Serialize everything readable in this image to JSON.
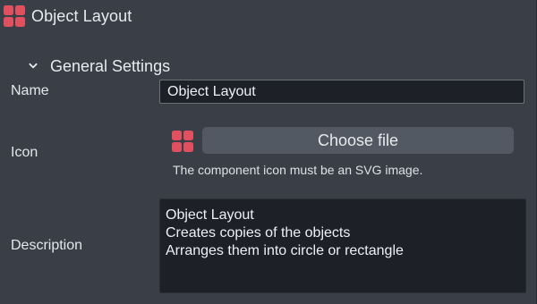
{
  "window": {
    "title": "Object Layout",
    "icon": "component-grid-icon"
  },
  "section": {
    "title": "General Settings",
    "expanded": true,
    "icon": "chevron-down-icon"
  },
  "fields": {
    "name": {
      "label": "Name",
      "value": "Object Layout"
    },
    "icon": {
      "label": "Icon",
      "preview_icon": "component-grid-icon",
      "button_label": "Choose file",
      "hint": "The component icon must be an SVG image."
    },
    "description": {
      "label": "Description",
      "lines": [
        "Object Layout",
        "Creates copies of the objects",
        "Arranges them into circle or rectangle"
      ]
    }
  },
  "colors": {
    "background": "#3a3f47",
    "input_background": "#1d2127",
    "button_background": "#525963",
    "icon_accent": "#e0505f",
    "text": "#e4e6ea"
  }
}
